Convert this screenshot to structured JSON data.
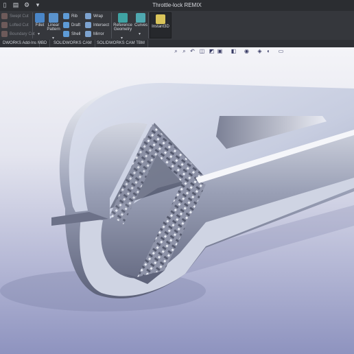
{
  "window": {
    "title": "Throttle-lock REMIX"
  },
  "ribbon": {
    "swept_cut": "Swept Cut",
    "lofted_cut": "Lofted Cut",
    "boundary_cut": "Boundary Cut",
    "fillet": "Fillet",
    "linear_pattern_line1": "Linear",
    "linear_pattern_line2": "Pattern",
    "rib": "Rib",
    "draft": "Draft",
    "shell": "Shell",
    "wrap": "Wrap",
    "intersect": "Intersect",
    "mirror": "Mirror",
    "reference_geometry_line1": "Reference",
    "reference_geometry_line2": "Geometry",
    "curves": "Curves",
    "instant3d": "Instant3D"
  },
  "tabs": [
    "DWORKS Add-Ins",
    "MBD",
    "SOLIDWORKS CAM",
    "SOLIDWORKS CAM TBM"
  ],
  "colors": {
    "accent": "#3b8fd9",
    "model": "#c9cfe0",
    "background_top": "#ffffff",
    "background_bottom": "#8e93bf"
  }
}
